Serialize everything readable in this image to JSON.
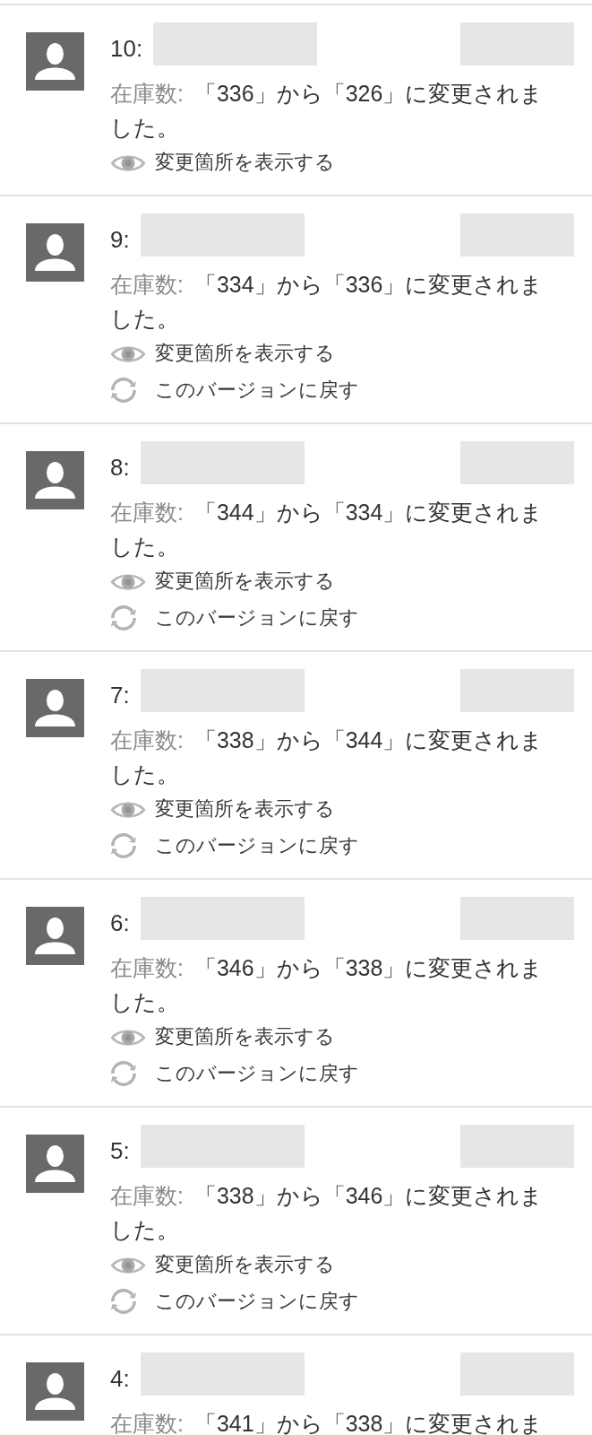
{
  "revisions": [
    {
      "number": "10:",
      "field_label": "在庫数:",
      "message": "「336」から「326」に変更されました。",
      "actions": [
        {
          "kind": "view_changes",
          "label": "変更箇所を表示する"
        }
      ]
    },
    {
      "number": "9:",
      "field_label": "在庫数:",
      "message": "「334」から「336」に変更されました。",
      "actions": [
        {
          "kind": "view_changes",
          "label": "変更箇所を表示する"
        },
        {
          "kind": "revert",
          "label": "このバージョンに戻す"
        }
      ]
    },
    {
      "number": "8:",
      "field_label": "在庫数:",
      "message": "「344」から「334」に変更されました。",
      "actions": [
        {
          "kind": "view_changes",
          "label": "変更箇所を表示する"
        },
        {
          "kind": "revert",
          "label": "このバージョンに戻す"
        }
      ]
    },
    {
      "number": "7:",
      "field_label": "在庫数:",
      "message": "「338」から「344」に変更されました。",
      "actions": [
        {
          "kind": "view_changes",
          "label": "変更箇所を表示する"
        },
        {
          "kind": "revert",
          "label": "このバージョンに戻す"
        }
      ]
    },
    {
      "number": "6:",
      "field_label": "在庫数:",
      "message": "「346」から「338」に変更されました。",
      "actions": [
        {
          "kind": "view_changes",
          "label": "変更箇所を表示する"
        },
        {
          "kind": "revert",
          "label": "このバージョンに戻す"
        }
      ]
    },
    {
      "number": "5:",
      "field_label": "在庫数:",
      "message": "「338」から「346」に変更されました。",
      "actions": [
        {
          "kind": "view_changes",
          "label": "変更箇所を表示する"
        },
        {
          "kind": "revert",
          "label": "このバージョンに戻す"
        }
      ]
    },
    {
      "number": "4:",
      "field_label": "在庫数:",
      "message": "「341」から「338」に変更されま"
    }
  ]
}
